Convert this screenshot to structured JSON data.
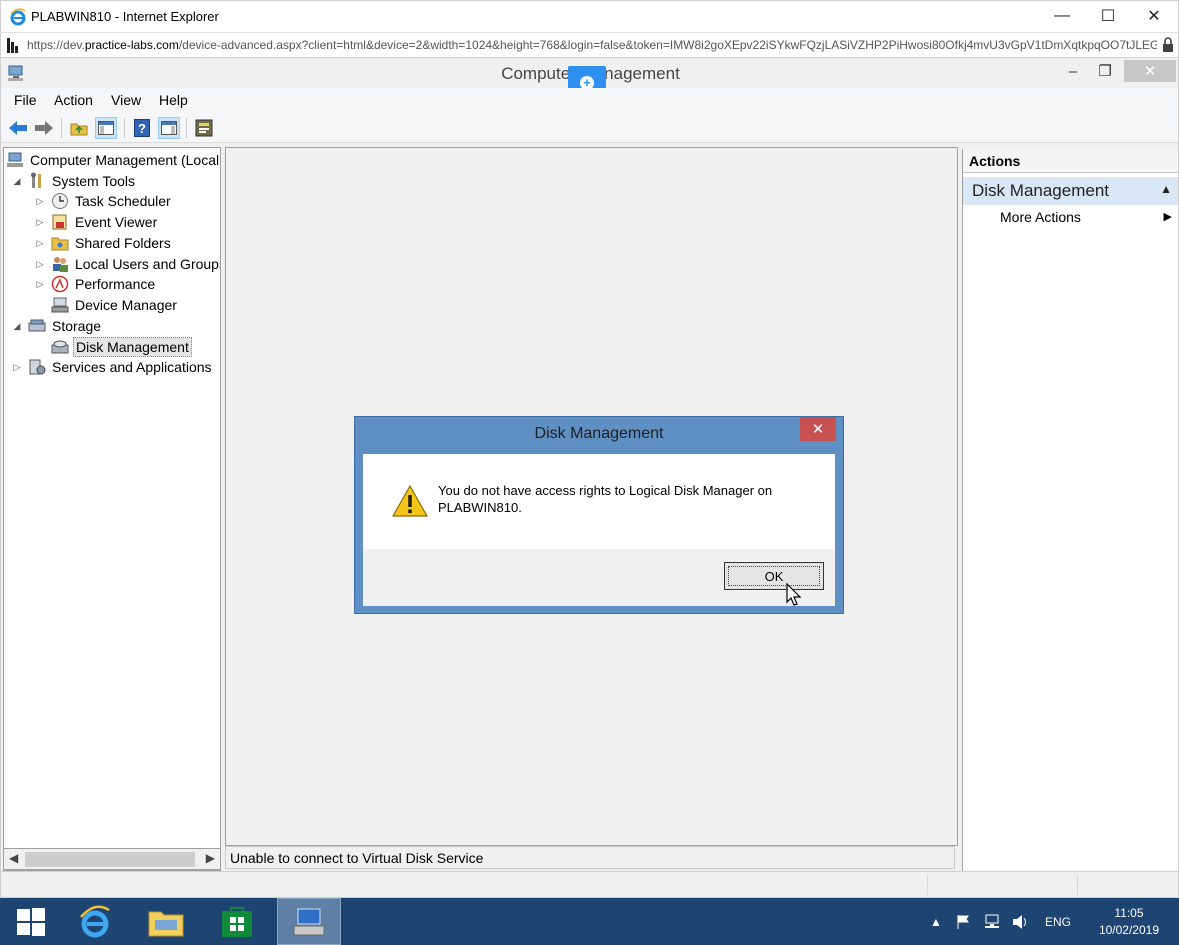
{
  "browser": {
    "title": "PLABWIN810 - Internet Explorer",
    "url_prefix": "https://dev.",
    "url_domain": "practice-labs.com",
    "url_rest": "/device-advanced.aspx?client=html&device=2&width=1024&height=768&login=false&token=IMW8i2goXEpv22iSYkwFQzjLASiVZHP2PiHwosi80Ofkj4mvU3vGpV1tDmXqtkpqOO7tJLEG",
    "minimize": "—",
    "maximize": "☐",
    "close": "✕"
  },
  "mmc": {
    "title": "Computer Management",
    "minimize": "‒",
    "restore": "❐",
    "close": "✕"
  },
  "menu": {
    "file": "File",
    "action": "Action",
    "view": "View",
    "help": "Help"
  },
  "tree": {
    "root": "Computer Management (Local",
    "system_tools": "System Tools",
    "task_scheduler": "Task Scheduler",
    "event_viewer": "Event Viewer",
    "shared_folders": "Shared Folders",
    "local_users": "Local Users and Groups",
    "performance": "Performance",
    "device_manager": "Device Manager",
    "storage": "Storage",
    "disk_management": "Disk Management",
    "services": "Services and Applications"
  },
  "status": {
    "message": "Unable to connect to Virtual Disk Service"
  },
  "actions": {
    "header": "Actions",
    "section": "Disk Management",
    "more_actions": "More Actions"
  },
  "dialog": {
    "title": "Disk Management",
    "close": "✕",
    "message": "You do not have access rights to Logical Disk Manager on PLABWIN810.",
    "ok": "OK"
  },
  "taskbar": {
    "language": "ENG",
    "time": "11:05",
    "date": "10/02/2019"
  },
  "colors": {
    "taskbar": "#1e4471",
    "dialog_frame": "#5f90c4",
    "dialog_close": "#c75050",
    "actions_section": "#d8e6f5"
  }
}
